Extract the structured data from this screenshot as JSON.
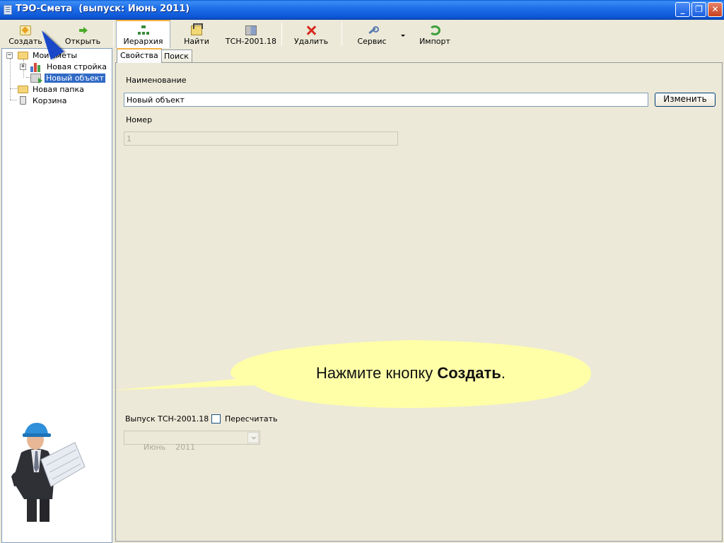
{
  "window": {
    "title": "ТЭО-Смета  (выпуск: Июнь 2011)",
    "controls": [
      "minimize",
      "maximize",
      "close"
    ]
  },
  "toolbar": {
    "create": "Создать",
    "open": "Открыть",
    "hierarchy": "Иерархия",
    "find": "Найти",
    "tsn": "ТСН-2001.18",
    "delete": "Удалить",
    "service": "Сервис",
    "import": "Импорт"
  },
  "tree": {
    "items": [
      {
        "label": "Мои сметы",
        "icon": "folder-open-icon",
        "expanded": true
      },
      {
        "label": "Новая стройка",
        "icon": "building-chart-icon",
        "expanded": false
      },
      {
        "label": "Новый объект",
        "icon": "object-icon",
        "selected": true
      },
      {
        "label": "Новая папка",
        "icon": "folder-icon"
      },
      {
        "label": "Корзина",
        "icon": "recycle-bin-icon"
      }
    ]
  },
  "tabs": [
    {
      "label": "Свойства",
      "active": true
    },
    {
      "label": "Поиск",
      "active": false
    }
  ],
  "form": {
    "name_label": "Наименование",
    "name_value": "Новый объект",
    "change_button": "Изменить",
    "number_label": "Номер",
    "number_value": "1",
    "release_label": "Выпуск ТСН-2001.18",
    "recalc_label": "Пересчитать",
    "release_value": "Июнь    2011"
  },
  "callout": {
    "text_prefix": "Нажмите кнопку ",
    "text_bold": "Создать",
    "text_suffix": "."
  },
  "colors": {
    "titlebar": "#0c55d5",
    "selection": "#316ac5",
    "callout_fill": "#ffffa8",
    "window_bg": "#ece9d8"
  }
}
